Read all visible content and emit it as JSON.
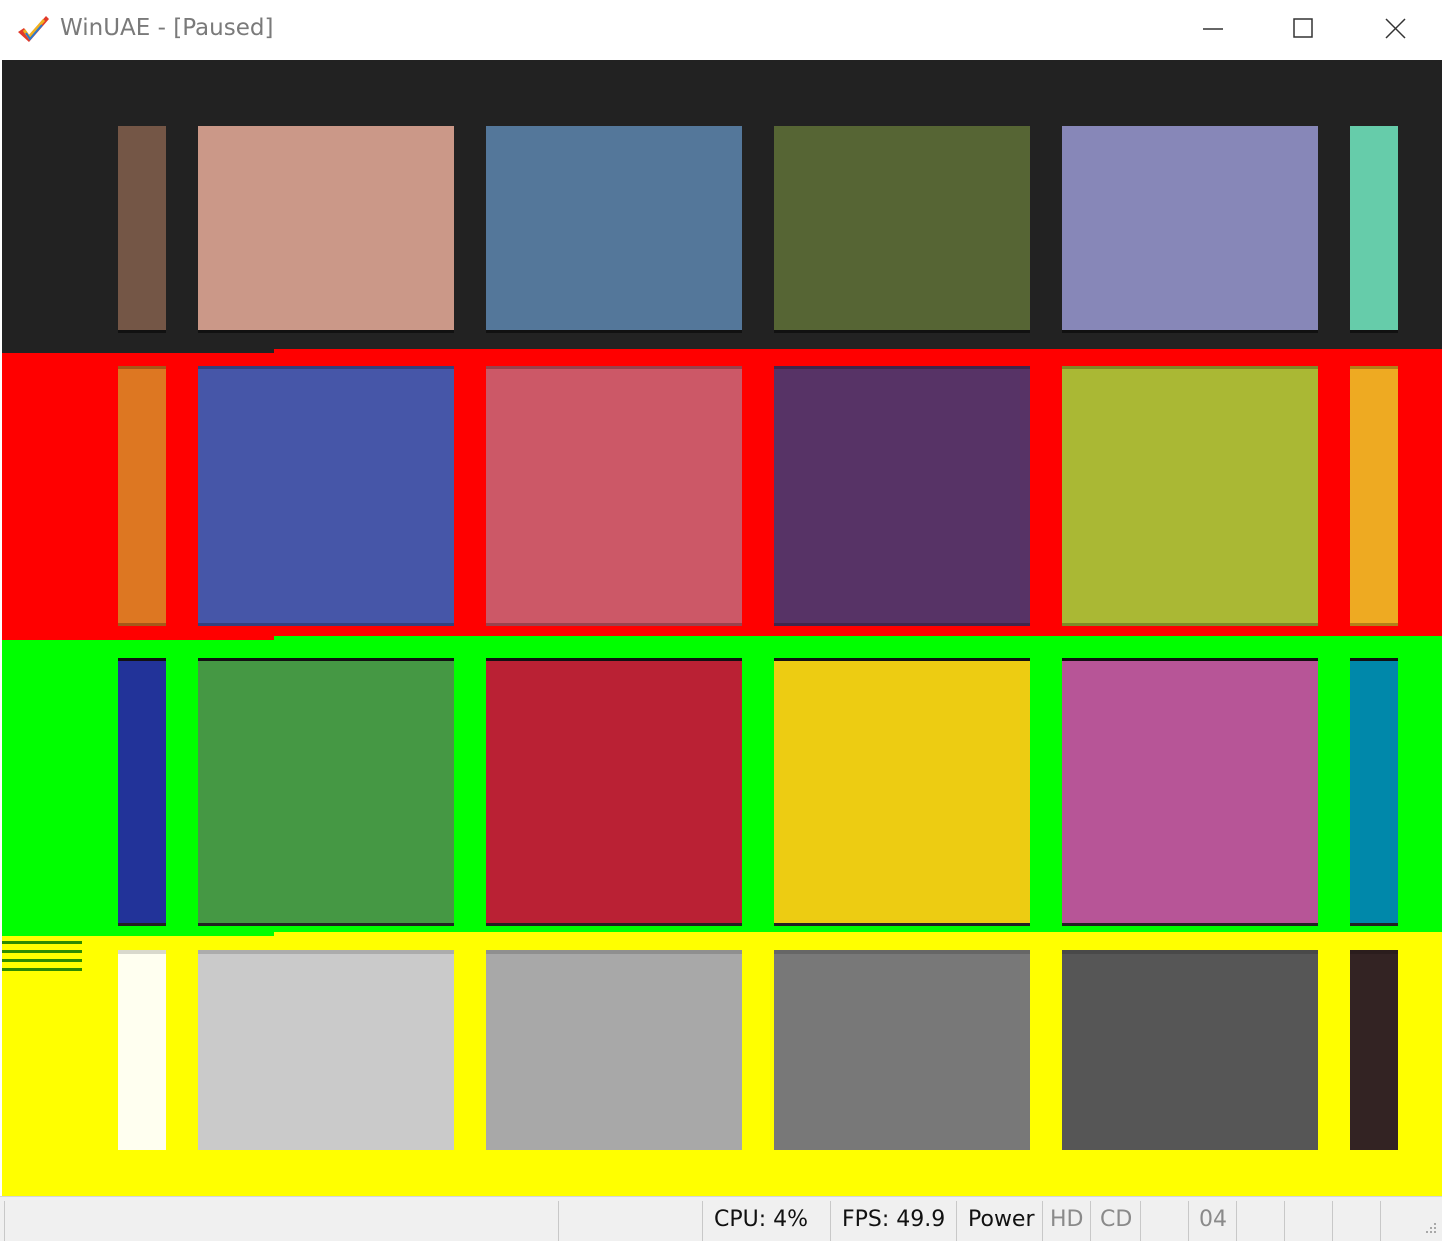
{
  "window": {
    "title": "WinUAE - [Paused]",
    "controls": [
      "minimize",
      "maximize",
      "close"
    ]
  },
  "palette": {
    "screen_background": "#222222",
    "rows": [
      {
        "band_color": "#222222",
        "swatches": [
          "#745646",
          "#cb9888",
          "#54779a",
          "#566534",
          "#8787b8",
          "#66ccaa"
        ]
      },
      {
        "band_color": "#ff0000",
        "swatches": [
          "#dd7722",
          "#4656a8",
          "#cc5867",
          "#573366",
          "#aab834",
          "#eeaa22"
        ]
      },
      {
        "band_color": "#00ff00",
        "swatches": [
          "#223399",
          "#459844",
          "#ba2134",
          "#edcc12",
          "#b75597",
          "#0088aa"
        ]
      },
      {
        "band_color": "#ffff00",
        "swatches": [
          "#fffff0",
          "#cacaca",
          "#a8a8a8",
          "#787878",
          "#565656",
          "#332323"
        ]
      }
    ]
  },
  "statusbar": {
    "cpu": "CPU: 4%",
    "fps": "FPS: 49.9",
    "power": "Power",
    "hd": "HD",
    "cd": "CD",
    "drive_track": "04"
  }
}
